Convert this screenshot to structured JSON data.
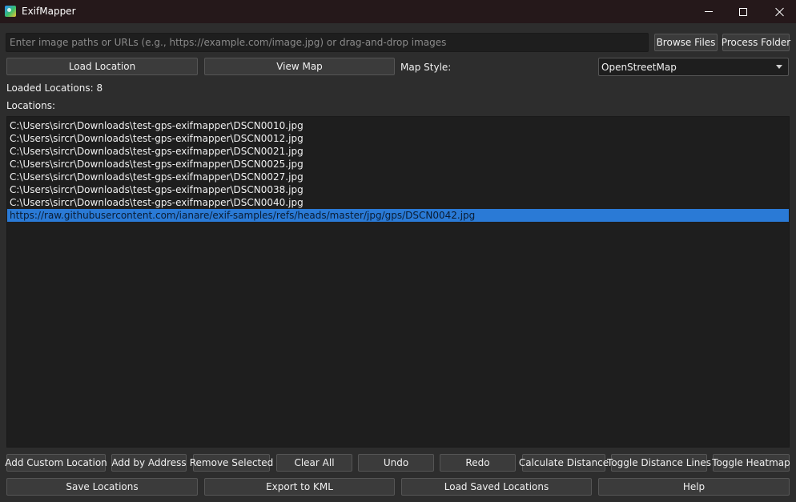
{
  "window": {
    "title": "ExifMapper",
    "icon": "exifmapper-app-icon"
  },
  "input_row": {
    "path_placeholder": "Enter image paths or URLs (e.g., https://example.com/image.jpg) or drag-and-drop images",
    "browse_label": "Browse Files",
    "process_folder_label": "Process Folder"
  },
  "controls_row": {
    "load_location_label": "Load Location",
    "view_map_label": "View Map",
    "map_style_label": "Map Style:",
    "map_style_value": "OpenStreetMap"
  },
  "status": {
    "loaded_locations": "Loaded Locations: 8"
  },
  "list": {
    "header": "Locations:",
    "items": [
      "C:\\Users\\sircr\\Downloads\\test-gps-exifmapper\\DSCN0010.jpg",
      "C:\\Users\\sircr\\Downloads\\test-gps-exifmapper\\DSCN0012.jpg",
      "C:\\Users\\sircr\\Downloads\\test-gps-exifmapper\\DSCN0021.jpg",
      "C:\\Users\\sircr\\Downloads\\test-gps-exifmapper\\DSCN0025.jpg",
      "C:\\Users\\sircr\\Downloads\\test-gps-exifmapper\\DSCN0027.jpg",
      "C:\\Users\\sircr\\Downloads\\test-gps-exifmapper\\DSCN0038.jpg",
      "C:\\Users\\sircr\\Downloads\\test-gps-exifmapper\\DSCN0040.jpg",
      "https://raw.githubusercontent.com/ianare/exif-samples/refs/heads/master/jpg/gps/DSCN0042.jpg"
    ],
    "selected_index": 7
  },
  "actions_row1": {
    "add_custom": "Add Custom Location",
    "add_by_address": "Add by Address",
    "remove_selected": "Remove Selected",
    "clear_all": "Clear All",
    "undo": "Undo",
    "redo": "Redo",
    "calculate_distance": "Calculate Distance",
    "toggle_distance_lines": "Toggle Distance Lines",
    "toggle_heatmap": "Toggle Heatmap"
  },
  "actions_row2": {
    "save_locations": "Save Locations",
    "export_kml": "Export to KML",
    "load_saved": "Load Saved Locations",
    "help": "Help"
  },
  "colors": {
    "background": "#2d2d2d",
    "titlebar": "#25181a",
    "input_bg": "#1e1e1e",
    "button_bg": "#3b3b3b",
    "selection": "#2a7ad6"
  }
}
